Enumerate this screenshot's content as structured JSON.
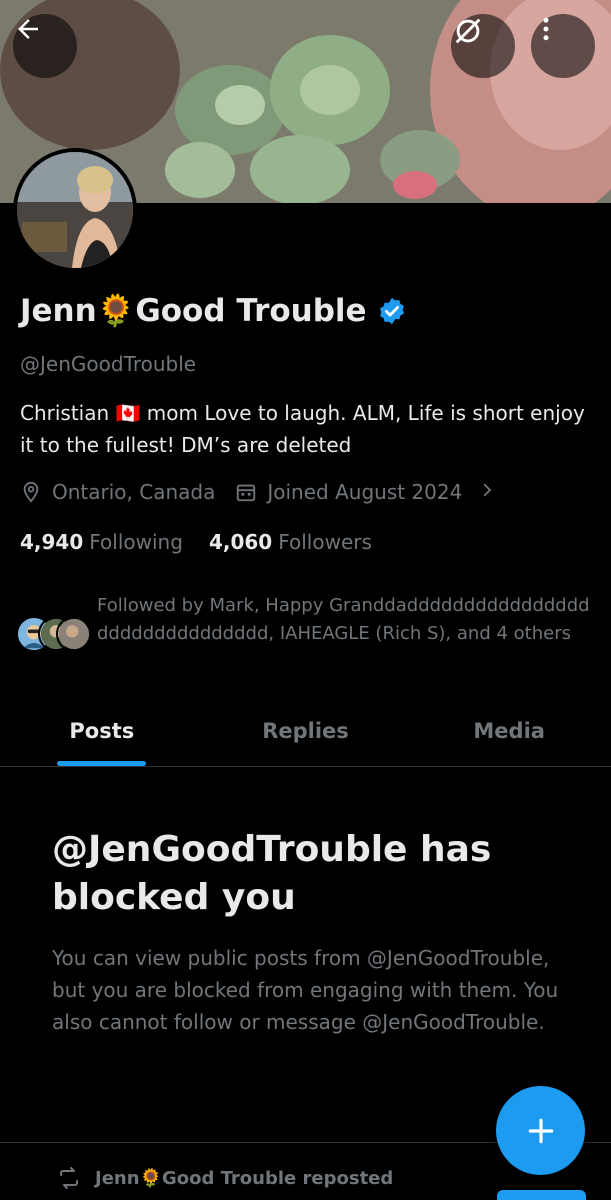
{
  "header": {
    "back_icon": "arrow-left-icon",
    "sync_icon": "sync-off-icon",
    "more_icon": "more-vertical-icon"
  },
  "profile": {
    "name_part1": "Jenn",
    "name_emoji": "🌻",
    "name_part2": "Good Trouble",
    "handle": "@JenGoodTrouble",
    "bio": "Christian 🇨🇦 mom Love to laugh. ALM, Life is short enjoy it to the fullest! DM’s are deleted",
    "location": "Ontario, Canada",
    "joined": "Joined August 2024",
    "following_count": "4,940",
    "following_label": "Following",
    "followers_count": "4,060",
    "followers_label": "Followers",
    "followed_by": "Followed by Mark, Happy Granddaddddddddddddddddddddddddddddddd, IAHEAGLE (Rich S), and 4 others"
  },
  "tabs": [
    {
      "label": "Posts"
    },
    {
      "label": "Replies"
    },
    {
      "label": "Media"
    }
  ],
  "blocked": {
    "title": "@JenGoodTrouble has blocked you",
    "description": "You can view public posts from @JenGoodTrouble, but you are blocked from engaging with them. You also cannot follow or message @JenGoodTrouble."
  },
  "repost": {
    "name_part1": "Jenn",
    "name_emoji": "🌻",
    "name_part2": "Good Trouble reposted"
  },
  "colors": {
    "accent": "#1d9bf0",
    "text_primary": "#e7e9ea",
    "text_secondary": "#71767b",
    "background": "#000000"
  }
}
